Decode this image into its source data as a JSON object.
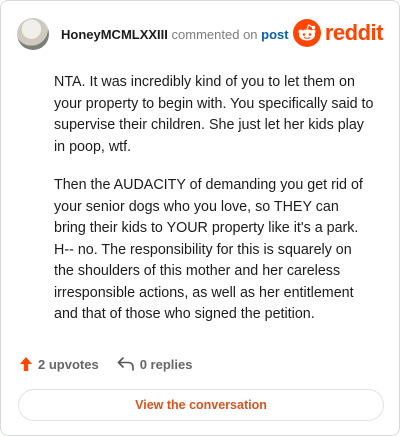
{
  "comment": {
    "username": "HoneyMCMLXXIII",
    "action_text": "commented on",
    "post_link": "post",
    "paragraphs": [
      "NTA. It was incredibly kind of you to let them on your property to begin with. You specifically said to supervise their children. She just let her kids play in poop, wtf.",
      "Then the AUDACITY of demanding you get rid of your senior dogs who you love, so THEY can bring their kids to YOUR property like it's a park. H-- no. The responsibility for this is squarely on the shoulders of this mother and her careless irresponsible actions, as well as her entitlement and that of those who signed the petition."
    ]
  },
  "brand": {
    "wordmark": "reddit",
    "icon": "reddit-logo-icon",
    "color": "#ff4500"
  },
  "stats": {
    "upvotes_label": "2 upvotes",
    "upvote_icon": "upvote-arrow-icon",
    "replies_label": "0 replies",
    "reply_icon": "reply-arrow-icon",
    "upvote_color": "#ff4500"
  },
  "cta": {
    "label": "View the conversation",
    "color": "#d9541e"
  }
}
